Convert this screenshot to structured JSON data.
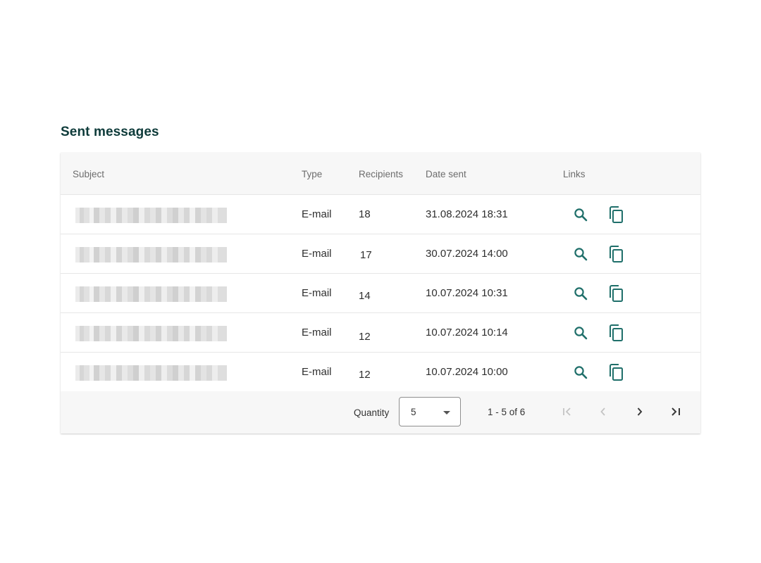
{
  "page_title": "Sent messages",
  "table": {
    "columns": [
      "Subject",
      "Type",
      "Recipients",
      "Date sent",
      "Links"
    ],
    "rows": [
      {
        "subject": "",
        "type": "E-mail",
        "recipients": "18",
        "date_sent": "31.08.2024 18:31"
      },
      {
        "subject": "",
        "type": "E-mail",
        "recipients": "17",
        "date_sent": "30.07.2024 14:00"
      },
      {
        "subject": "",
        "type": "E-mail",
        "recipients": "14",
        "date_sent": "10.07.2024 10:31"
      },
      {
        "subject": "",
        "type": "E-mail",
        "recipients": "12",
        "date_sent": "10.07.2024 10:14"
      },
      {
        "subject": "",
        "type": "E-mail",
        "recipients": "12",
        "date_sent": "10.07.2024 10:00"
      }
    ],
    "row_icons": [
      "search-icon",
      "copy-icon"
    ]
  },
  "pagination": {
    "quantity_label": "Quantity",
    "quantity_value": "5",
    "range_text": "1 - 5 of 6",
    "buttons": [
      "first-page-icon",
      "previous-page-icon",
      "next-page-icon",
      "last-page-icon"
    ]
  },
  "colors": {
    "accent": "#1f6f6a",
    "title": "#0e3b3a",
    "disabled": "#bdbdbd"
  }
}
